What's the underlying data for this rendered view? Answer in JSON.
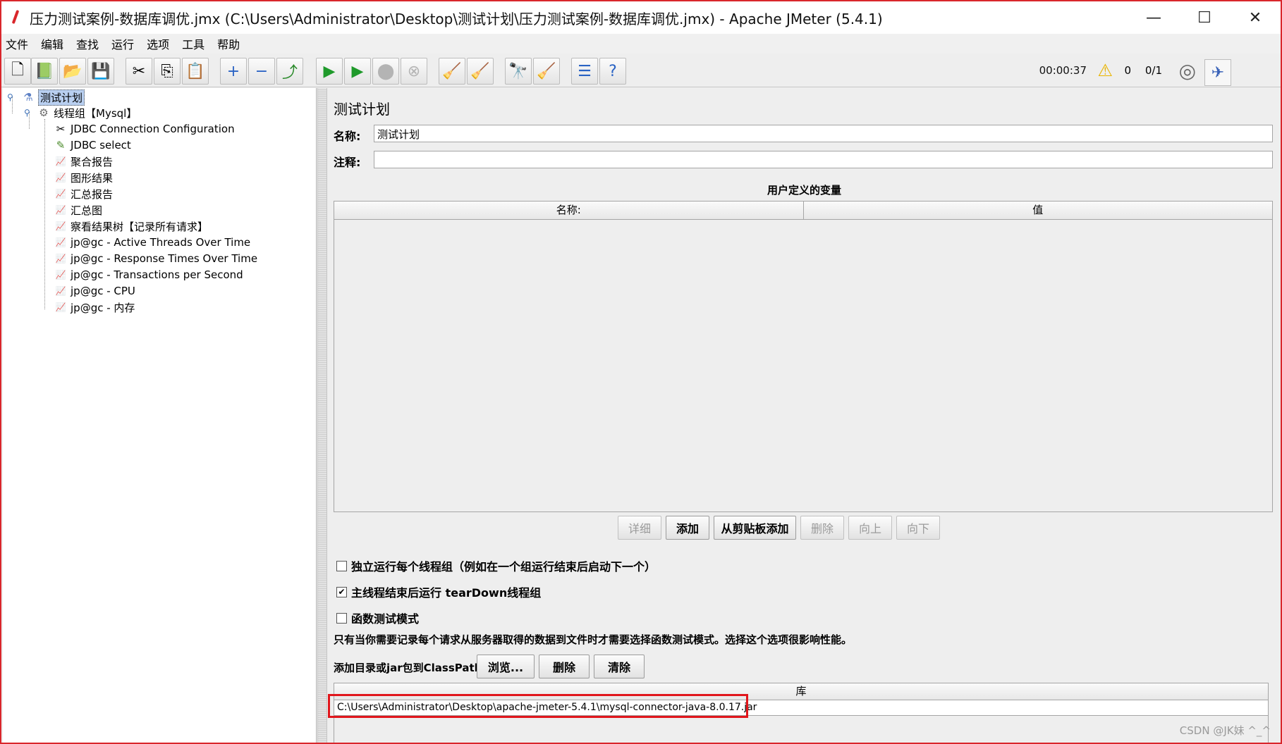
{
  "window": {
    "title": "压力测试案例-数据库调优.jmx (C:\\Users\\Administrator\\Desktop\\测试计划\\压力测试案例-数据库调优.jmx) - Apache JMeter (5.4.1)",
    "minimize": "—",
    "maximize": "☐",
    "close": "✕"
  },
  "menu": [
    "文件",
    "编辑",
    "查找",
    "运行",
    "选项",
    "工具",
    "帮助"
  ],
  "toolbar": {
    "elapsed": "00:00:37",
    "warnings": "0",
    "threads": "0/1"
  },
  "tree": [
    {
      "label": "测试计划",
      "icon": "test-plan-icon",
      "glyph": "⚗"
    },
    {
      "label": "线程组【Mysql】",
      "icon": "thread-group-icon",
      "glyph": "⚙"
    },
    {
      "label": "JDBC Connection Configuration",
      "icon": "config-tools-icon",
      "glyph": "✂"
    },
    {
      "label": "JDBC select",
      "icon": "sampler-pen-icon",
      "glyph": "✎"
    },
    {
      "label": "聚合报告",
      "icon": "listener-chart-icon",
      "glyph": "📈"
    },
    {
      "label": "图形结果",
      "icon": "listener-chart-icon",
      "glyph": "📈"
    },
    {
      "label": "汇总报告",
      "icon": "listener-chart-icon",
      "glyph": "📈"
    },
    {
      "label": "汇总图",
      "icon": "listener-chart-icon",
      "glyph": "📈"
    },
    {
      "label": "察看结果树【记录所有请求】",
      "icon": "listener-chart-icon",
      "glyph": "📈"
    },
    {
      "label": "jp@gc - Active Threads Over Time",
      "icon": "listener-chart-icon",
      "glyph": "📈"
    },
    {
      "label": "jp@gc - Response Times Over Time",
      "icon": "listener-chart-icon",
      "glyph": "📈"
    },
    {
      "label": "jp@gc - Transactions per Second",
      "icon": "listener-chart-icon",
      "glyph": "📈"
    },
    {
      "label": "jp@gc - CPU",
      "icon": "listener-chart-icon",
      "glyph": "📈"
    },
    {
      "label": "jp@gc - 内存",
      "icon": "listener-chart-icon",
      "glyph": "📈"
    }
  ],
  "panel": {
    "title": "测试计划",
    "name_label": "名称:",
    "name_value": "测试计划",
    "comment_label": "注释:",
    "comment_value": "",
    "vars_title": "用户定义的变量",
    "vars_col_name": "名称:",
    "vars_col_value": "值",
    "buttons": {
      "detail": "详细",
      "add": "添加",
      "add_clipboard": "从剪贴板添加",
      "delete": "删除",
      "up": "向上",
      "down": "向下"
    },
    "options": {
      "independent": "独立运行每个线程组（例如在一个组运行结束后启动下一个）",
      "teardown": "主线程结束后运行 tearDown线程组",
      "functional": "函数测试模式"
    },
    "functional_note": "只有当你需要记录每个请求从服务器取得的数据到文件时才需要选择函数测试模式。选择这个选项很影响性能。",
    "classpath_label": "添加目录或jar包到ClassPath",
    "classpath_buttons": {
      "browse": "浏览...",
      "delete": "删除",
      "clear": "清除"
    },
    "lib_header": "库",
    "lib_rows": [
      "C:\\Users\\Administrator\\Desktop\\apache-jmeter-5.4.1\\mysql-connector-java-8.0.17.jar"
    ]
  },
  "watermark": "CSDN @JK妹  ^_^"
}
